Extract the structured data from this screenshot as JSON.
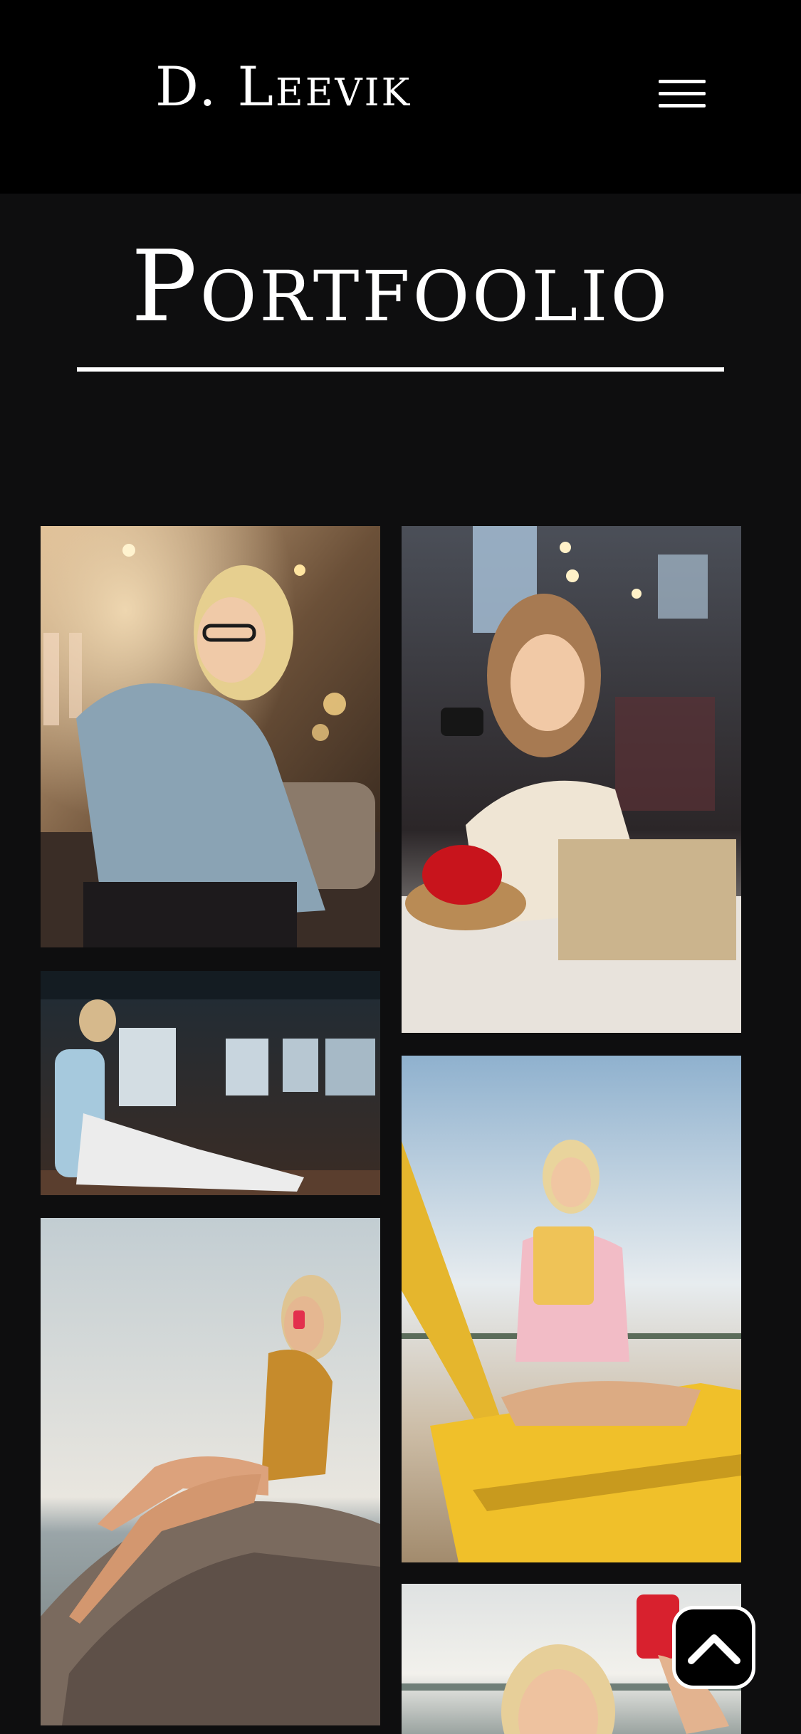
{
  "header": {
    "brand": "D. Leevik",
    "menu_icon": "hamburger-menu-icon"
  },
  "page": {
    "title": "Portfoolio"
  },
  "gallery": {
    "photos": [
      {
        "subject": "woman in sweater on phone with glasses"
      },
      {
        "subject": "woman with coffee cup and laptop in cafe"
      },
      {
        "subject": "woman with laptop under pier"
      },
      {
        "subject": "woman with tablet on yellow bench at beach"
      },
      {
        "subject": "woman on phone sitting on rock by the sea"
      },
      {
        "subject": "woman taking selfie at beach"
      }
    ]
  },
  "scroll_top": {
    "icon": "chevron-up-icon"
  },
  "colors": {
    "header_bg": "#000000",
    "page_bg": "#0e0e0f",
    "text": "#ffffff"
  }
}
